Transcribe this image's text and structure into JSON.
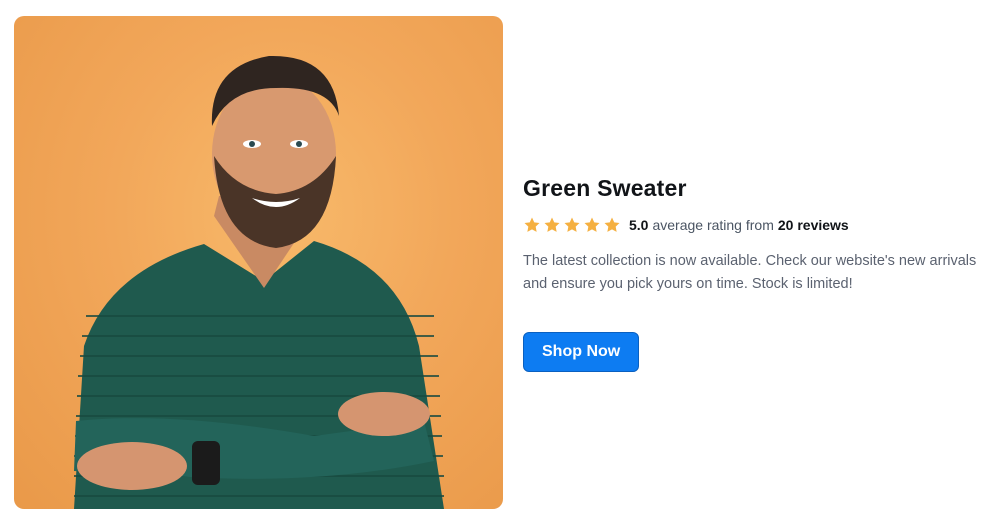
{
  "product": {
    "image_alt": "Smiling man with crossed arms wearing green knit sweater",
    "title": "Green Sweater",
    "rating": {
      "stars": 5,
      "star_icon": "star-icon",
      "star_color": "#f5b041",
      "score": "5.0",
      "text_middle": "average rating from",
      "reviews": "20 reviews"
    },
    "description": "The latest collection is now available. Check our website's new arrivals and ensure you pick yours on time. Stock is limited!",
    "cta_label": "Shop Now",
    "cta_color": "#0d7cf2"
  }
}
